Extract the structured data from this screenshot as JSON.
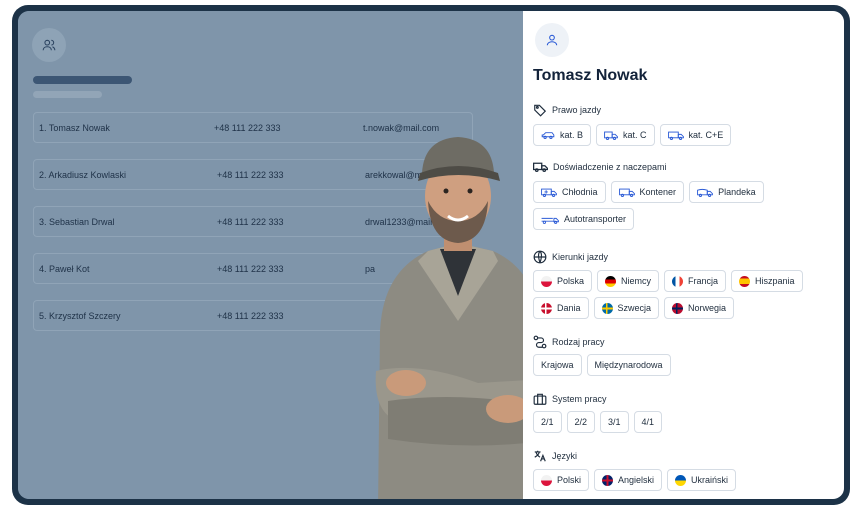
{
  "profile": {
    "name": "Tomasz Nowak",
    "sections": {
      "license": {
        "title": "Prawo jazdy",
        "items": [
          "kat. B",
          "kat. C",
          "kat. C+E"
        ]
      },
      "trailers": {
        "title": "Doświadczenie z naczepami",
        "items": [
          "Chłodnia",
          "Kontener",
          "Plandeka",
          "Autotransporter"
        ]
      },
      "directions": {
        "title": "Kierunki jazdy",
        "items": [
          "Polska",
          "Niemcy",
          "Francja",
          "Hiszpania",
          "Dania",
          "Szwecja",
          "Norwegia"
        ]
      },
      "work_type": {
        "title": "Rodzaj pracy",
        "items": [
          "Krajowa",
          "Międzynarodowa"
        ]
      },
      "work_system": {
        "title": "System pracy",
        "items": [
          "2/1",
          "2/2",
          "3/1",
          "4/1"
        ]
      },
      "languages": {
        "title": "Języki",
        "items": [
          "Polski",
          "Angielski",
          "Ukraiński"
        ]
      }
    }
  },
  "list": {
    "rows": [
      {
        "name": "1. Tomasz Nowak",
        "phone": "+48 111 222 333",
        "email": "t.nowak@mail.com"
      },
      {
        "name": "2. Arkadiusz Kowlaski",
        "phone": "+48 111 222 333",
        "email": "arekkowal@ma"
      },
      {
        "name": "3. Sebastian Drwal",
        "phone": "+48 111 222 333",
        "email": "drwal1233@mail."
      },
      {
        "name": "4. Paweł Kot",
        "phone": "+48 111 222 333",
        "email": "pa"
      },
      {
        "name": "5. Krzysztof Szczery",
        "phone": "+48 111 222 333",
        "email": ""
      }
    ]
  },
  "colors": {
    "frame": "#1c3247",
    "overlay": "#7f95aa",
    "panel": "#ffffff"
  }
}
